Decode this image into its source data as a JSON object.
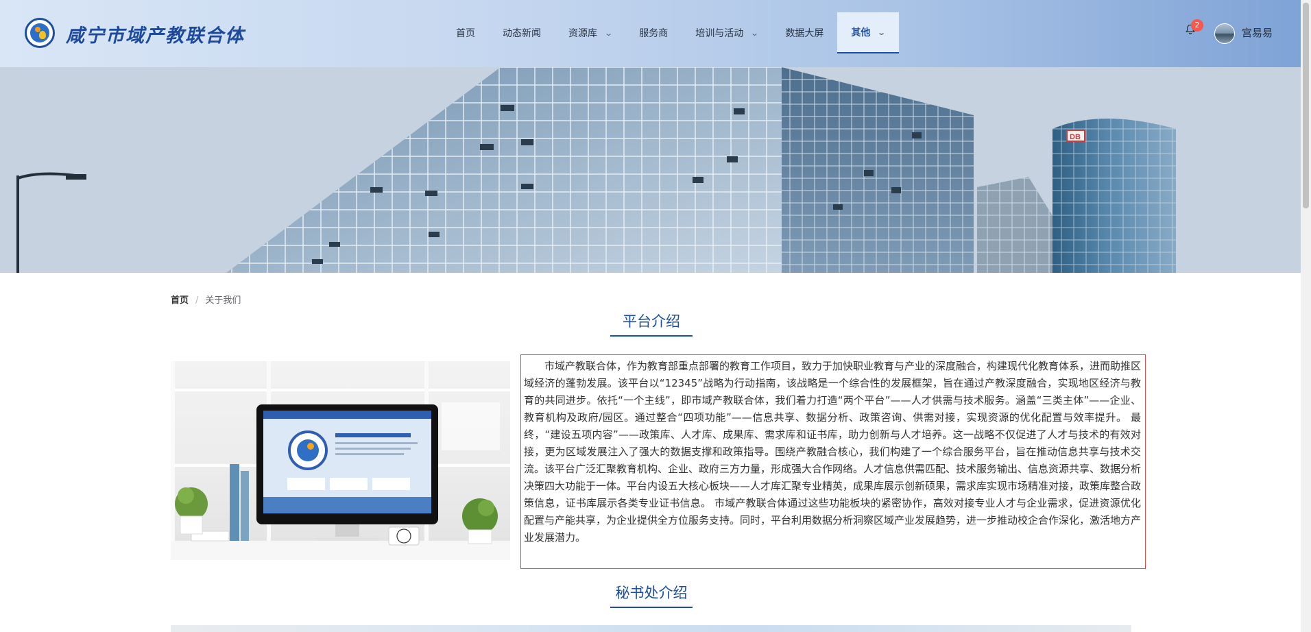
{
  "header": {
    "site_title": "咸宁市域产教联合体",
    "logo_icon": "logo-emblem-icon",
    "notifications_count": "2",
    "username": "宫易易"
  },
  "nav": {
    "items": [
      {
        "label": "首页",
        "dropdown": false
      },
      {
        "label": "动态新闻",
        "dropdown": false
      },
      {
        "label": "资源库",
        "dropdown": true
      },
      {
        "label": "服务商",
        "dropdown": false
      },
      {
        "label": "培训与活动",
        "dropdown": true
      },
      {
        "label": "数据大屏",
        "dropdown": false
      },
      {
        "label": "其他",
        "dropdown": true,
        "active": true
      }
    ]
  },
  "banner": {
    "logo_sign": "DB"
  },
  "breadcrumb": {
    "home": "首页",
    "separator": "/",
    "current": "关于我们"
  },
  "sections": {
    "platform_title": "平台介绍",
    "platform_text": "市域产教联合体，作为教育部重点部署的教育工作项目，致力于加快职业教育与产业的深度融合，构建现代化教育体系，进而助推区域经济的蓬勃发展。该平台以“12345”战略为行动指南，该战略是一个综合性的发展框架，旨在通过产教深度融合，实现地区经济与教育的共同进步。依托“一个主线”，即市域产教联合体，我们着力打造“两个平台”——人才供需与技术服务。涵盖“三类主体”——企业、教育机构及政府/园区。通过整合“四项功能”——信息共享、数据分析、政策咨询、供需对接，实现资源的优化配置与效率提升。 最终，“建设五项内容”——政策库、人才库、成果库、需求库和证书库，助力创新与人才培养。这一战略不仅促进了人才与技术的有效对接，更为区域发展注入了强大的数据支撑和政策指导。围绕产教融合核心，我们构建了一个综合服务平台，旨在推动信息共享与技术交流。该平台广泛汇聚教育机构、企业、政府三方力量，形成强大合作网络。人才信息供需匹配、技术服务输出、信息资源共享、数据分析决策四大功能于一体。平台内设五大核心板块——人才库汇聚专业精英，成果库展示创新硕果，需求库实现市场精准对接，政策库整合政策信息，证书库展示各类专业证书信息。 市域产教联合体通过这些功能板块的紧密协作，高效对接专业人才与企业需求，促进资源优化配置与产能共享，为企业提供全方位服务支持。同时，平台利用数据分析洞察区域产业发展趋势，进一步推动校企合作深化，激活地方产业发展潜力。",
    "secretariat_title": "秘书处介绍"
  },
  "colors": {
    "brand": "#1d4f9c",
    "badge": "#f5584c",
    "highlight_border": "#e5494b"
  }
}
